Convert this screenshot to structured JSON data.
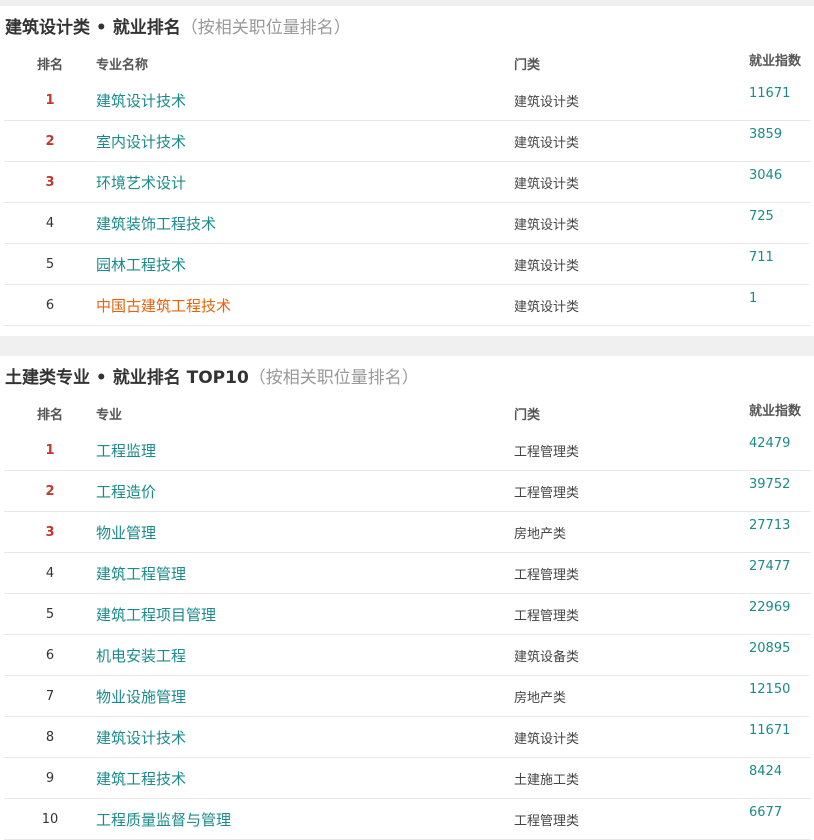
{
  "section1": {
    "title": "建筑设计类 • 就业排名",
    "note": "（按相关职位量排名）",
    "headers": {
      "rank": "排名",
      "name": "专业名称",
      "category": "门类",
      "index": "就业指数"
    },
    "rows": [
      {
        "rank": "1",
        "name": "建筑设计技术",
        "category": "建筑设计类",
        "index": "11671"
      },
      {
        "rank": "2",
        "name": "室内设计技术",
        "category": "建筑设计类",
        "index": "3859"
      },
      {
        "rank": "3",
        "name": "环境艺术设计",
        "category": "建筑设计类",
        "index": "3046"
      },
      {
        "rank": "4",
        "name": "建筑装饰工程技术",
        "category": "建筑设计类",
        "index": "725"
      },
      {
        "rank": "5",
        "name": "园林工程技术",
        "category": "建筑设计类",
        "index": "711"
      },
      {
        "rank": "6",
        "name": "中国古建筑工程技术",
        "category": "建筑设计类",
        "index": "1"
      }
    ]
  },
  "section2": {
    "title": "土建类专业 • 就业排名 TOP10",
    "note": "（按相关职位量排名）",
    "headers": {
      "rank": "排名",
      "name": "专业",
      "category": "门类",
      "index": "就业指数"
    },
    "rows": [
      {
        "rank": "1",
        "name": "工程监理",
        "category": "工程管理类",
        "index": "42479"
      },
      {
        "rank": "2",
        "name": "工程造价",
        "category": "工程管理类",
        "index": "39752"
      },
      {
        "rank": "3",
        "name": "物业管理",
        "category": "房地产类",
        "index": "27713"
      },
      {
        "rank": "4",
        "name": "建筑工程管理",
        "category": "工程管理类",
        "index": "27477"
      },
      {
        "rank": "5",
        "name": "建筑工程项目管理",
        "category": "工程管理类",
        "index": "22969"
      },
      {
        "rank": "6",
        "name": "机电安装工程",
        "category": "建筑设备类",
        "index": "20895"
      },
      {
        "rank": "7",
        "name": "物业设施管理",
        "category": "房地产类",
        "index": "12150"
      },
      {
        "rank": "8",
        "name": "建筑设计技术",
        "category": "建筑设计类",
        "index": "11671"
      },
      {
        "rank": "9",
        "name": "建筑工程技术",
        "category": "土建施工类",
        "index": "8424"
      },
      {
        "rank": "10",
        "name": "工程质量监督与管理",
        "category": "工程管理类",
        "index": "6677"
      }
    ]
  },
  "colors": {
    "link": "#1a8a8a",
    "highlight": "#e8630a",
    "top_rank": "#c0392b"
  }
}
